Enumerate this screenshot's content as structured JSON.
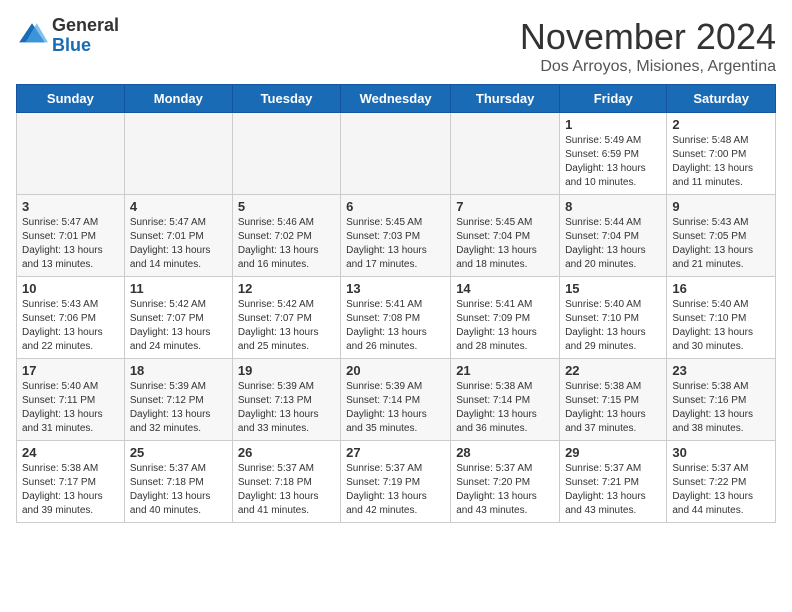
{
  "header": {
    "logo_general": "General",
    "logo_blue": "Blue",
    "month_title": "November 2024",
    "subtitle": "Dos Arroyos, Misiones, Argentina"
  },
  "columns": [
    "Sunday",
    "Monday",
    "Tuesday",
    "Wednesday",
    "Thursday",
    "Friday",
    "Saturday"
  ],
  "weeks": [
    [
      {
        "day": "",
        "empty": true
      },
      {
        "day": "",
        "empty": true
      },
      {
        "day": "",
        "empty": true
      },
      {
        "day": "",
        "empty": true
      },
      {
        "day": "",
        "empty": true
      },
      {
        "day": "1",
        "sunrise": "5:49 AM",
        "sunset": "6:59 PM",
        "daylight": "13 hours and 10 minutes."
      },
      {
        "day": "2",
        "sunrise": "5:48 AM",
        "sunset": "7:00 PM",
        "daylight": "13 hours and 11 minutes."
      }
    ],
    [
      {
        "day": "3",
        "sunrise": "5:47 AM",
        "sunset": "7:01 PM",
        "daylight": "13 hours and 13 minutes."
      },
      {
        "day": "4",
        "sunrise": "5:47 AM",
        "sunset": "7:01 PM",
        "daylight": "13 hours and 14 minutes."
      },
      {
        "day": "5",
        "sunrise": "5:46 AM",
        "sunset": "7:02 PM",
        "daylight": "13 hours and 16 minutes."
      },
      {
        "day": "6",
        "sunrise": "5:45 AM",
        "sunset": "7:03 PM",
        "daylight": "13 hours and 17 minutes."
      },
      {
        "day": "7",
        "sunrise": "5:45 AM",
        "sunset": "7:04 PM",
        "daylight": "13 hours and 18 minutes."
      },
      {
        "day": "8",
        "sunrise": "5:44 AM",
        "sunset": "7:04 PM",
        "daylight": "13 hours and 20 minutes."
      },
      {
        "day": "9",
        "sunrise": "5:43 AM",
        "sunset": "7:05 PM",
        "daylight": "13 hours and 21 minutes."
      }
    ],
    [
      {
        "day": "10",
        "sunrise": "5:43 AM",
        "sunset": "7:06 PM",
        "daylight": "13 hours and 22 minutes."
      },
      {
        "day": "11",
        "sunrise": "5:42 AM",
        "sunset": "7:07 PM",
        "daylight": "13 hours and 24 minutes."
      },
      {
        "day": "12",
        "sunrise": "5:42 AM",
        "sunset": "7:07 PM",
        "daylight": "13 hours and 25 minutes."
      },
      {
        "day": "13",
        "sunrise": "5:41 AM",
        "sunset": "7:08 PM",
        "daylight": "13 hours and 26 minutes."
      },
      {
        "day": "14",
        "sunrise": "5:41 AM",
        "sunset": "7:09 PM",
        "daylight": "13 hours and 28 minutes."
      },
      {
        "day": "15",
        "sunrise": "5:40 AM",
        "sunset": "7:10 PM",
        "daylight": "13 hours and 29 minutes."
      },
      {
        "day": "16",
        "sunrise": "5:40 AM",
        "sunset": "7:10 PM",
        "daylight": "13 hours and 30 minutes."
      }
    ],
    [
      {
        "day": "17",
        "sunrise": "5:40 AM",
        "sunset": "7:11 PM",
        "daylight": "13 hours and 31 minutes."
      },
      {
        "day": "18",
        "sunrise": "5:39 AM",
        "sunset": "7:12 PM",
        "daylight": "13 hours and 32 minutes."
      },
      {
        "day": "19",
        "sunrise": "5:39 AM",
        "sunset": "7:13 PM",
        "daylight": "13 hours and 33 minutes."
      },
      {
        "day": "20",
        "sunrise": "5:39 AM",
        "sunset": "7:14 PM",
        "daylight": "13 hours and 35 minutes."
      },
      {
        "day": "21",
        "sunrise": "5:38 AM",
        "sunset": "7:14 PM",
        "daylight": "13 hours and 36 minutes."
      },
      {
        "day": "22",
        "sunrise": "5:38 AM",
        "sunset": "7:15 PM",
        "daylight": "13 hours and 37 minutes."
      },
      {
        "day": "23",
        "sunrise": "5:38 AM",
        "sunset": "7:16 PM",
        "daylight": "13 hours and 38 minutes."
      }
    ],
    [
      {
        "day": "24",
        "sunrise": "5:38 AM",
        "sunset": "7:17 PM",
        "daylight": "13 hours and 39 minutes."
      },
      {
        "day": "25",
        "sunrise": "5:37 AM",
        "sunset": "7:18 PM",
        "daylight": "13 hours and 40 minutes."
      },
      {
        "day": "26",
        "sunrise": "5:37 AM",
        "sunset": "7:18 PM",
        "daylight": "13 hours and 41 minutes."
      },
      {
        "day": "27",
        "sunrise": "5:37 AM",
        "sunset": "7:19 PM",
        "daylight": "13 hours and 42 minutes."
      },
      {
        "day": "28",
        "sunrise": "5:37 AM",
        "sunset": "7:20 PM",
        "daylight": "13 hours and 43 minutes."
      },
      {
        "day": "29",
        "sunrise": "5:37 AM",
        "sunset": "7:21 PM",
        "daylight": "13 hours and 43 minutes."
      },
      {
        "day": "30",
        "sunrise": "5:37 AM",
        "sunset": "7:22 PM",
        "daylight": "13 hours and 44 minutes."
      }
    ]
  ],
  "labels": {
    "sunrise": "Sunrise:",
    "sunset": "Sunset:",
    "daylight": "Daylight:"
  }
}
